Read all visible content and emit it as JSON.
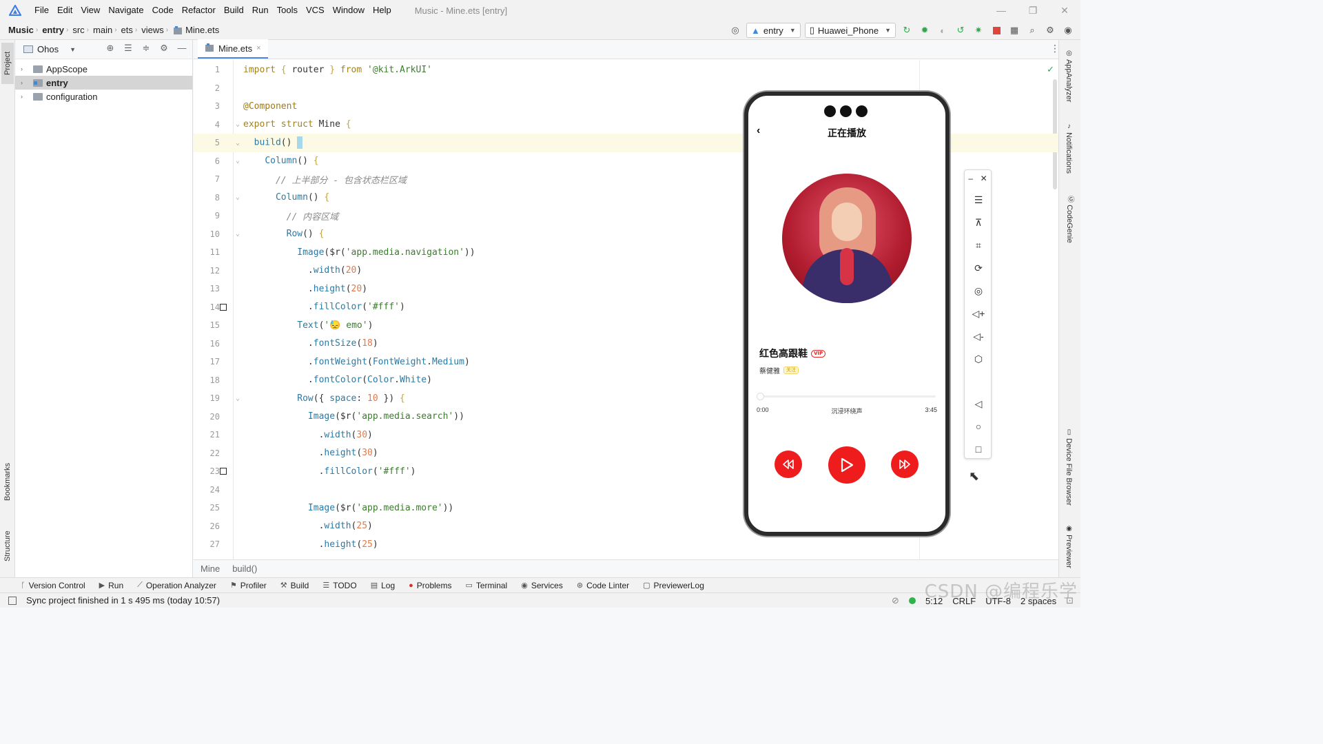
{
  "menubar": {
    "items": [
      "File",
      "Edit",
      "View",
      "Navigate",
      "Code",
      "Refactor",
      "Build",
      "Run",
      "Tools",
      "VCS",
      "Window",
      "Help"
    ],
    "window_title": "Music - Mine.ets [entry]",
    "controls": {
      "minimize": "—",
      "restore": "❐",
      "close": "✕"
    }
  },
  "navbar": {
    "crumbs": [
      "Music",
      "entry",
      "src",
      "main",
      "ets",
      "views",
      "Mine.ets"
    ],
    "module_combo": "entry",
    "device_combo": "Huawei_Phone"
  },
  "left_strip": {
    "project": "Project",
    "bookmarks": "Bookmarks",
    "structure": "Structure"
  },
  "project_panel": {
    "view_mode": "Ohos",
    "tree": [
      {
        "label": "AppScope",
        "selected": false
      },
      {
        "label": "entry",
        "selected": true
      },
      {
        "label": "configuration",
        "selected": false
      }
    ]
  },
  "editor": {
    "tab": "Mine.ets",
    "tab_close": "×",
    "current_line": 5
  },
  "editor_crumb": {
    "file": "Mine",
    "func": "build()"
  },
  "right_strip": {
    "appanalyzer": "AppAnalyzer",
    "notifications": "Notifications",
    "codegenie": "CodeGenie",
    "device_file_browser": "Device File Browser",
    "previewer": "Previewer"
  },
  "phone": {
    "back": "‹",
    "title": "正在播放",
    "song": "红色高跟鞋",
    "vip": "VIP",
    "artist": "蔡健雅",
    "follow": "关注",
    "time_start": "0:00",
    "mode": "沉浸环绕声",
    "time_end": "3:45",
    "progress": 0
  },
  "bottom_tools": {
    "items": [
      "Version Control",
      "Run",
      "Operation Analyzer",
      "Profiler",
      "Build",
      "TODO",
      "Log",
      "Problems",
      "Terminal",
      "Services",
      "Code Linter",
      "PreviewerLog"
    ]
  },
  "status": {
    "message": "Sync project finished in 1 s 495 ms (today 10:57)",
    "position": "5:12",
    "line_sep": "CRLF",
    "encoding": "UTF-8",
    "indent": "2 spaces"
  },
  "watermark": "CSDN @编程乐学",
  "colors": {
    "accent": "#ee1c1c",
    "selection": "#d5d5d5",
    "current_line": "#fcfae5"
  }
}
